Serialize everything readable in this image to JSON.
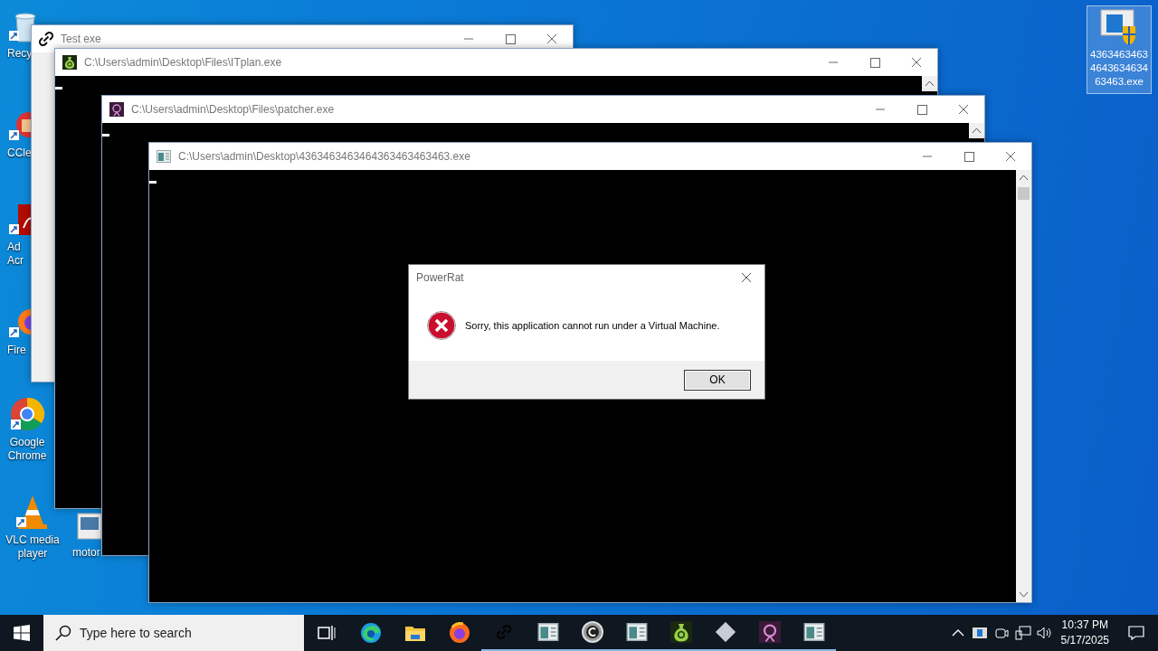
{
  "desktop_icons": [
    {
      "label": "Recy",
      "cut": true
    },
    {
      "label": "CCle",
      "cut": true
    },
    {
      "label": "Ad Acr",
      "cut": true
    },
    {
      "label": "Fire",
      "cut": true
    },
    {
      "label": "Google Chrome",
      "cut": false
    },
    {
      "label": "VLC media player",
      "cut": false
    },
    {
      "label": "motor",
      "cut": true
    }
  ],
  "file_icon": {
    "label": "4363463463464363463463463.exe",
    "selected": true
  },
  "windows": [
    {
      "title": "Test exe",
      "kind": "blank"
    },
    {
      "title": "C:\\Users\\admin\\Desktop\\Files\\ITplan.exe",
      "kind": "console"
    },
    {
      "title": "C:\\Users\\admin\\Desktop\\Files\\patcher.exe",
      "kind": "console"
    },
    {
      "title": "C:\\Users\\admin\\Desktop\\4363463463464363463463463.exe",
      "kind": "console"
    }
  ],
  "dialog": {
    "title": "PowerRat",
    "message": "Sorry, this application cannot run under a Virtual Machine.",
    "button": "OK"
  },
  "taskbar": {
    "search_placeholder": "Type here to search",
    "apps": [
      {
        "running": false
      },
      {
        "running": false
      },
      {
        "running": false
      },
      {
        "running": false
      },
      {
        "running": true
      },
      {
        "running": true
      },
      {
        "running": true
      },
      {
        "running": true
      },
      {
        "running": true
      },
      {
        "running": true
      },
      {
        "running": true
      },
      {
        "running": true
      }
    ],
    "time": "10:37 PM",
    "date": "5/17/2025"
  }
}
